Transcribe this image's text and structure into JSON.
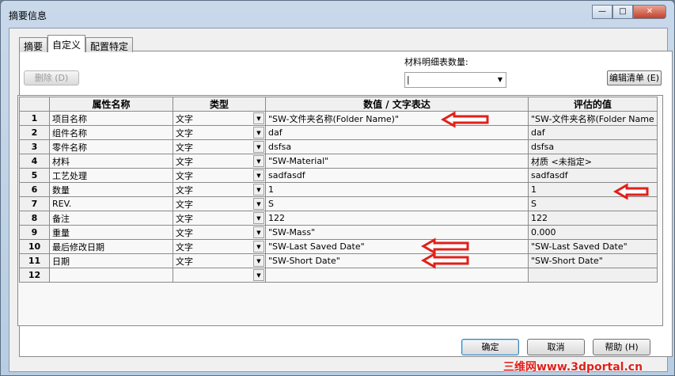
{
  "window": {
    "title": "摘要信息",
    "minimize": "—",
    "maximize": "□",
    "close": "✕"
  },
  "tabs": [
    {
      "label": "摘要"
    },
    {
      "label": "自定义"
    },
    {
      "label": "配置特定"
    }
  ],
  "delete_button": "删除 (D)",
  "bom_qty": {
    "label": "材料明细表数量:",
    "value": "|"
  },
  "edit_list_button": "编辑清单 (E)",
  "table": {
    "headers": [
      "",
      "属性名称",
      "类型",
      "数值 / 文字表达",
      "评估的值"
    ],
    "rows": [
      {
        "n": "1",
        "name": "项目名称",
        "type": "文字",
        "value": "\"SW-文件夹名称(Folder Name)\"",
        "eval": "\"SW-文件夹名称(Folder Name"
      },
      {
        "n": "2",
        "name": "组件名称",
        "type": "文字",
        "value": "daf",
        "eval": "daf"
      },
      {
        "n": "3",
        "name": "零件名称",
        "type": "文字",
        "value": "dsfsa",
        "eval": "dsfsa"
      },
      {
        "n": "4",
        "name": "材料",
        "type": "文字",
        "value": "\"SW-Material\"",
        "eval": "材质 <未指定>"
      },
      {
        "n": "5",
        "name": "工艺处理",
        "type": "文字",
        "value": "sadfasdf",
        "eval": "sadfasdf"
      },
      {
        "n": "6",
        "name": "数量",
        "type": "文字",
        "value": "1",
        "eval": "1"
      },
      {
        "n": "7",
        "name": "REV.",
        "type": "文字",
        "value": "S",
        "eval": "S"
      },
      {
        "n": "8",
        "name": "备注",
        "type": "文字",
        "value": "122",
        "eval": "122"
      },
      {
        "n": "9",
        "name": "重量",
        "type": "文字",
        "value": "\"SW-Mass\"",
        "eval": "0.000"
      },
      {
        "n": "10",
        "name": "最后修改日期",
        "type": "文字",
        "value": "\"SW-Last Saved Date\"",
        "eval": "\"SW-Last Saved Date\""
      },
      {
        "n": "11",
        "name": "日期",
        "type": "文字",
        "value": "\"SW-Short Date\"",
        "eval": "\"SW-Short Date\""
      },
      {
        "n": "12",
        "name": "",
        "type": "",
        "value": "",
        "eval": ""
      }
    ]
  },
  "buttons": {
    "ok": "确定",
    "cancel": "取消",
    "help": "帮助 (H)"
  },
  "watermark": "三维网www.3dportal.cn",
  "colors": {
    "annotation_arrow": "#e0201a"
  }
}
